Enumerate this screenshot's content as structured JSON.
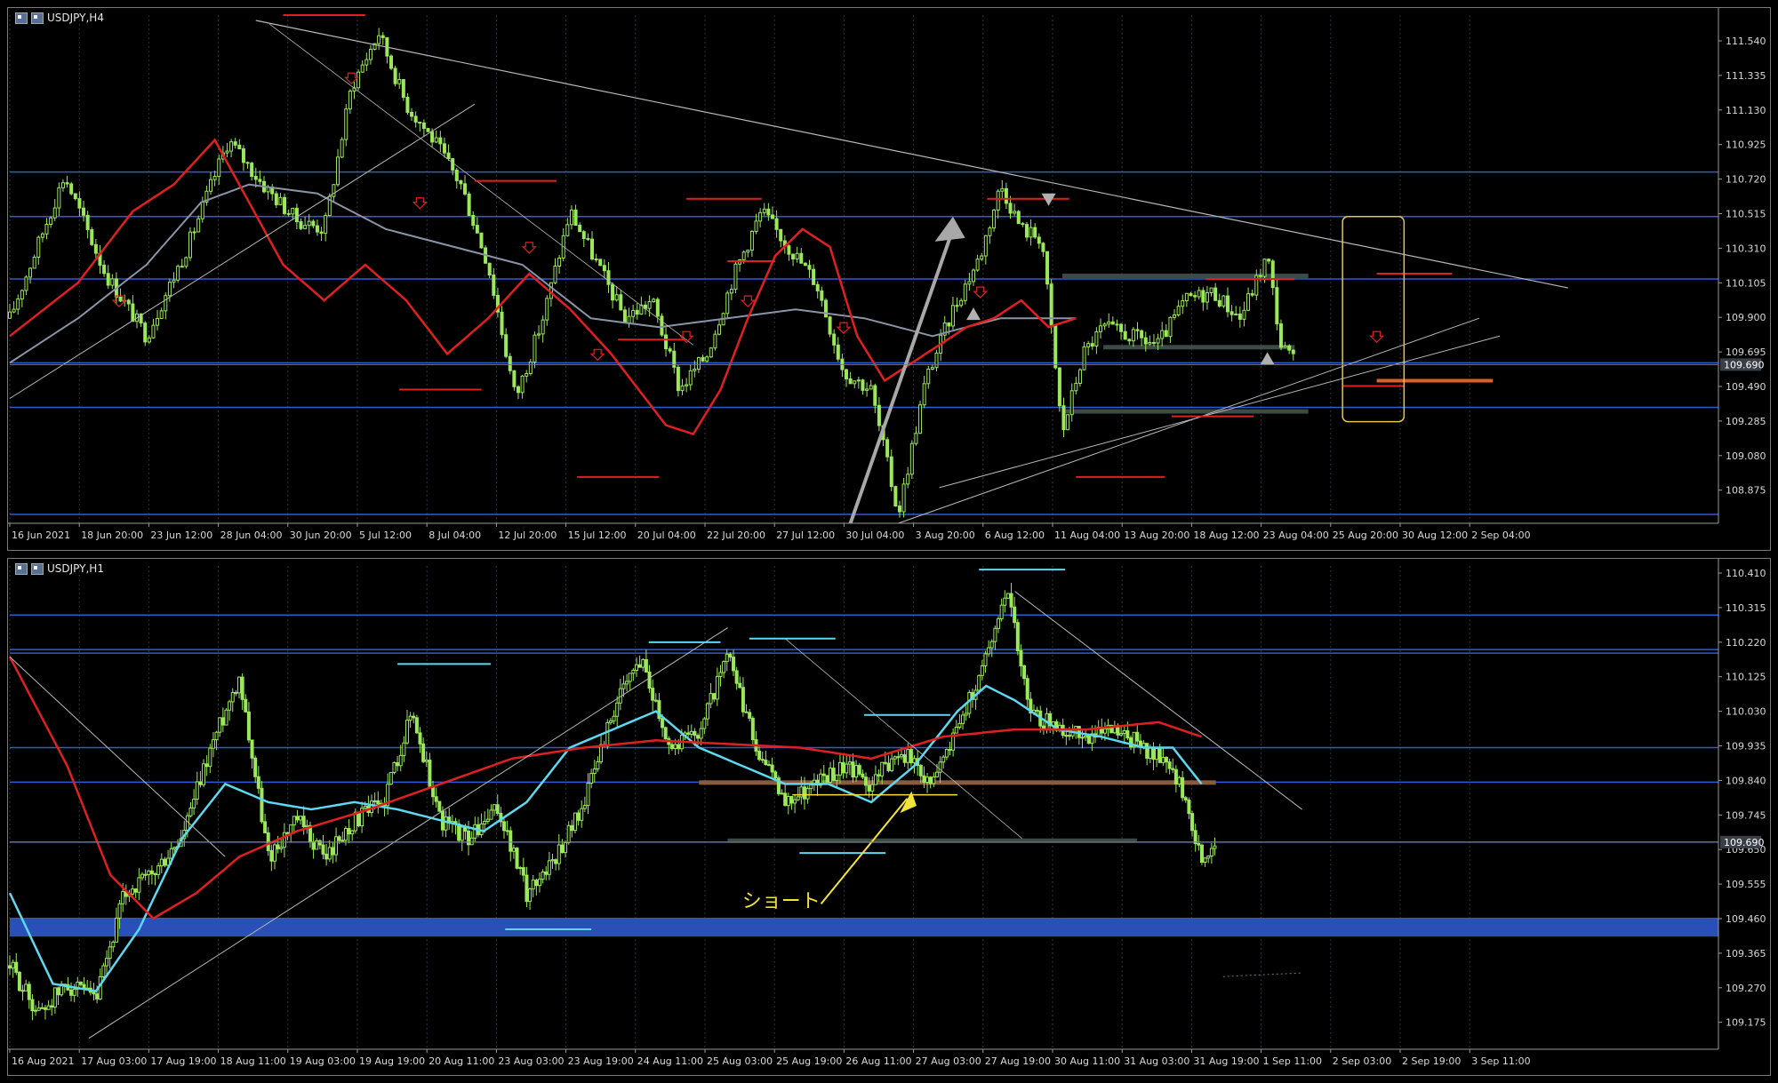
{
  "charts": [
    {
      "id": "h4",
      "title": "USDJPY,H4",
      "price_ticks": [
        "111.540",
        "111.335",
        "111.130",
        "110.925",
        "110.720",
        "110.515",
        "110.310",
        "110.105",
        "109.900",
        "109.695",
        "109.490",
        "109.285",
        "109.080",
        "108.875"
      ],
      "price_range": [
        108.8,
        111.65
      ],
      "current_price": "109.690",
      "time_ticks": [
        "16 Jun 2021",
        "18 Jun 20:00",
        "23 Jun 12:00",
        "28 Jun 04:00",
        "30 Jun 20:00",
        "5 Jul 12:00",
        "8 Jul 04:00",
        "12 Jul 20:00",
        "15 Jul 12:00",
        "20 Jul 04:00",
        "22 Jul 20:00",
        "27 Jul 12:00",
        "30 Jul 04:00",
        "3 Aug 20:00",
        "6 Aug 12:00",
        "11 Aug 04:00",
        "13 Aug 20:00",
        "18 Aug 12:00",
        "23 Aug 04:00",
        "25 Aug 20:00",
        "30 Aug 12:00",
        "2 Sep 04:00"
      ],
      "close_path": [
        [
          0,
          109.95
        ],
        [
          8,
          110.75
        ],
        [
          14,
          110.2
        ],
        [
          20,
          109.85
        ],
        [
          26,
          110.35
        ],
        [
          32,
          110.95
        ],
        [
          37,
          110.7
        ],
        [
          42,
          110.5
        ],
        [
          46,
          110.45
        ],
        [
          50,
          111.25
        ],
        [
          54,
          111.55
        ],
        [
          58,
          111.15
        ],
        [
          62,
          110.95
        ],
        [
          66,
          110.7
        ],
        [
          70,
          110.25
        ],
        [
          74,
          109.5
        ],
        [
          78,
          109.95
        ],
        [
          82,
          110.55
        ],
        [
          86,
          110.25
        ],
        [
          90,
          109.95
        ],
        [
          94,
          110.05
        ],
        [
          98,
          109.55
        ],
        [
          102,
          109.75
        ],
        [
          106,
          110.2
        ],
        [
          110,
          110.55
        ],
        [
          114,
          110.35
        ],
        [
          118,
          110.15
        ],
        [
          122,
          109.65
        ],
        [
          126,
          109.55
        ],
        [
          130,
          108.85
        ],
        [
          134,
          109.6
        ],
        [
          138,
          110.0
        ],
        [
          142,
          110.3
        ],
        [
          145,
          110.7
        ],
        [
          148,
          110.45
        ],
        [
          151,
          110.4
        ],
        [
          154,
          109.3
        ],
        [
          157,
          109.75
        ],
        [
          160,
          109.9
        ],
        [
          164,
          109.85
        ],
        [
          168,
          109.8
        ],
        [
          172,
          110.05
        ],
        [
          176,
          110.1
        ],
        [
          180,
          109.95
        ],
        [
          184,
          110.3
        ],
        [
          186,
          109.8
        ],
        [
          188,
          109.7
        ]
      ],
      "ma_red": [
        [
          0,
          109.85
        ],
        [
          10,
          110.15
        ],
        [
          18,
          110.55
        ],
        [
          24,
          110.7
        ],
        [
          30,
          110.95
        ],
        [
          35,
          110.6
        ],
        [
          40,
          110.25
        ],
        [
          46,
          110.05
        ],
        [
          52,
          110.25
        ],
        [
          58,
          110.05
        ],
        [
          64,
          109.75
        ],
        [
          70,
          109.95
        ],
        [
          76,
          110.2
        ],
        [
          82,
          110.0
        ],
        [
          88,
          109.75
        ],
        [
          92,
          109.55
        ],
        [
          96,
          109.35
        ],
        [
          100,
          109.3
        ],
        [
          104,
          109.55
        ],
        [
          108,
          109.95
        ],
        [
          112,
          110.3
        ],
        [
          116,
          110.45
        ],
        [
          120,
          110.35
        ],
        [
          124,
          109.85
        ],
        [
          128,
          109.6
        ],
        [
          132,
          109.7
        ],
        [
          136,
          109.8
        ],
        [
          140,
          109.9
        ],
        [
          144,
          109.95
        ],
        [
          148,
          110.05
        ],
        [
          152,
          109.9
        ],
        [
          156,
          109.95
        ]
      ],
      "ma_gray": [
        [
          0,
          109.7
        ],
        [
          10,
          109.95
        ],
        [
          20,
          110.25
        ],
        [
          28,
          110.6
        ],
        [
          35,
          110.7
        ],
        [
          45,
          110.65
        ],
        [
          55,
          110.45
        ],
        [
          65,
          110.35
        ],
        [
          75,
          110.25
        ],
        [
          85,
          109.95
        ],
        [
          95,
          109.9
        ],
        [
          105,
          109.95
        ],
        [
          115,
          110.0
        ],
        [
          125,
          109.95
        ],
        [
          135,
          109.85
        ],
        [
          145,
          109.95
        ],
        [
          156,
          109.95
        ]
      ],
      "hlines_blue": [
        110.77,
        110.52,
        110.17,
        109.7,
        109.45,
        108.85
      ],
      "annotation_text": ""
    },
    {
      "id": "h1",
      "title": "USDJPY,H1",
      "price_ticks": [
        "110.410",
        "110.315",
        "110.220",
        "110.125",
        "110.030",
        "109.935",
        "109.840",
        "109.745",
        "109.650",
        "109.555",
        "109.460",
        "109.365",
        "109.270",
        "109.175"
      ],
      "price_range": [
        109.12,
        110.45
      ],
      "current_price": "109.690",
      "time_ticks": [
        "16 Aug 2021",
        "17 Aug 03:00",
        "17 Aug 19:00",
        "18 Aug 11:00",
        "19 Aug 03:00",
        "19 Aug 19:00",
        "20 Aug 11:00",
        "23 Aug 03:00",
        "23 Aug 19:00",
        "24 Aug 11:00",
        "25 Aug 03:00",
        "25 Aug 19:00",
        "26 Aug 11:00",
        "27 Aug 03:00",
        "27 Aug 19:00",
        "30 Aug 11:00",
        "31 Aug 03:00",
        "31 Aug 19:00",
        "1 Sep 11:00",
        "2 Sep 03:00",
        "2 Sep 19:00",
        "3 Sep 11:00"
      ],
      "close_path": [
        [
          0,
          109.35
        ],
        [
          4,
          109.22
        ],
        [
          8,
          109.3
        ],
        [
          12,
          109.25
        ],
        [
          16,
          109.55
        ],
        [
          20,
          109.6
        ],
        [
          24,
          109.7
        ],
        [
          28,
          109.95
        ],
        [
          32,
          110.15
        ],
        [
          36,
          109.65
        ],
        [
          40,
          109.75
        ],
        [
          44,
          109.65
        ],
        [
          48,
          109.75
        ],
        [
          52,
          109.8
        ],
        [
          56,
          110.05
        ],
        [
          60,
          109.75
        ],
        [
          64,
          109.7
        ],
        [
          68,
          109.78
        ],
        [
          72,
          109.55
        ],
        [
          76,
          109.65
        ],
        [
          80,
          109.8
        ],
        [
          84,
          110.05
        ],
        [
          88,
          110.2
        ],
        [
          92,
          109.95
        ],
        [
          96,
          110.0
        ],
        [
          100,
          110.2
        ],
        [
          104,
          109.95
        ],
        [
          108,
          109.8
        ],
        [
          112,
          109.85
        ],
        [
          116,
          109.9
        ],
        [
          120,
          109.85
        ],
        [
          124,
          109.95
        ],
        [
          128,
          109.85
        ],
        [
          132,
          110.0
        ],
        [
          136,
          110.2
        ],
        [
          139,
          110.4
        ],
        [
          142,
          110.05
        ],
        [
          146,
          110.0
        ],
        [
          150,
          109.98
        ],
        [
          154,
          110.0
        ],
        [
          158,
          109.95
        ],
        [
          162,
          109.9
        ],
        [
          166,
          109.65
        ],
        [
          168,
          109.7
        ]
      ],
      "ma_cyan": [
        [
          0,
          109.55
        ],
        [
          6,
          109.3
        ],
        [
          12,
          109.28
        ],
        [
          18,
          109.45
        ],
        [
          24,
          109.7
        ],
        [
          30,
          109.85
        ],
        [
          36,
          109.8
        ],
        [
          42,
          109.78
        ],
        [
          48,
          109.8
        ],
        [
          54,
          109.78
        ],
        [
          60,
          109.75
        ],
        [
          66,
          109.72
        ],
        [
          72,
          109.8
        ],
        [
          78,
          109.95
        ],
        [
          84,
          110.0
        ],
        [
          90,
          110.05
        ],
        [
          96,
          109.95
        ],
        [
          102,
          109.9
        ],
        [
          108,
          109.85
        ],
        [
          114,
          109.85
        ],
        [
          120,
          109.8
        ],
        [
          126,
          109.9
        ],
        [
          132,
          110.05
        ],
        [
          136,
          110.12
        ],
        [
          140,
          110.08
        ],
        [
          146,
          110.0
        ],
        [
          152,
          109.98
        ],
        [
          158,
          109.95
        ],
        [
          162,
          109.95
        ],
        [
          166,
          109.85
        ]
      ],
      "ma_red": [
        [
          0,
          110.2
        ],
        [
          8,
          109.9
        ],
        [
          14,
          109.6
        ],
        [
          20,
          109.48
        ],
        [
          26,
          109.55
        ],
        [
          32,
          109.65
        ],
        [
          40,
          109.72
        ],
        [
          50,
          109.78
        ],
        [
          60,
          109.85
        ],
        [
          70,
          109.92
        ],
        [
          80,
          109.95
        ],
        [
          90,
          109.97
        ],
        [
          100,
          109.96
        ],
        [
          110,
          109.95
        ],
        [
          120,
          109.92
        ],
        [
          130,
          109.98
        ],
        [
          140,
          110.0
        ],
        [
          150,
          110.0
        ],
        [
          160,
          110.02
        ],
        [
          166,
          109.98
        ]
      ],
      "hlines_blue": [
        110.315,
        110.22,
        110.21,
        109.95,
        109.855,
        109.69,
        109.48,
        109.44
      ],
      "annotation_text": "ショート"
    }
  ]
}
